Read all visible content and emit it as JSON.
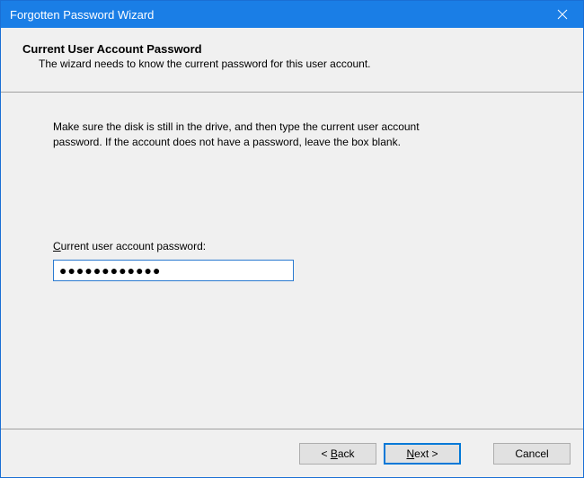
{
  "titlebar": {
    "title": "Forgotten Password Wizard",
    "close_label": "Close"
  },
  "header": {
    "title": "Current User Account Password",
    "subtitle": "The wizard needs to know the current password for this user account."
  },
  "content": {
    "instruction": "Make sure the disk is still in the drive, and then type the current user account password. If the account does not have a password, leave the box blank.",
    "field_label_pre": "C",
    "field_label_rest": "urrent user account password:",
    "password_value": "●●●●●●●●●●●●"
  },
  "footer": {
    "back_pre": "< ",
    "back_ul": "B",
    "back_rest": "ack",
    "next_ul": "N",
    "next_rest": "ext >",
    "cancel": "Cancel"
  }
}
